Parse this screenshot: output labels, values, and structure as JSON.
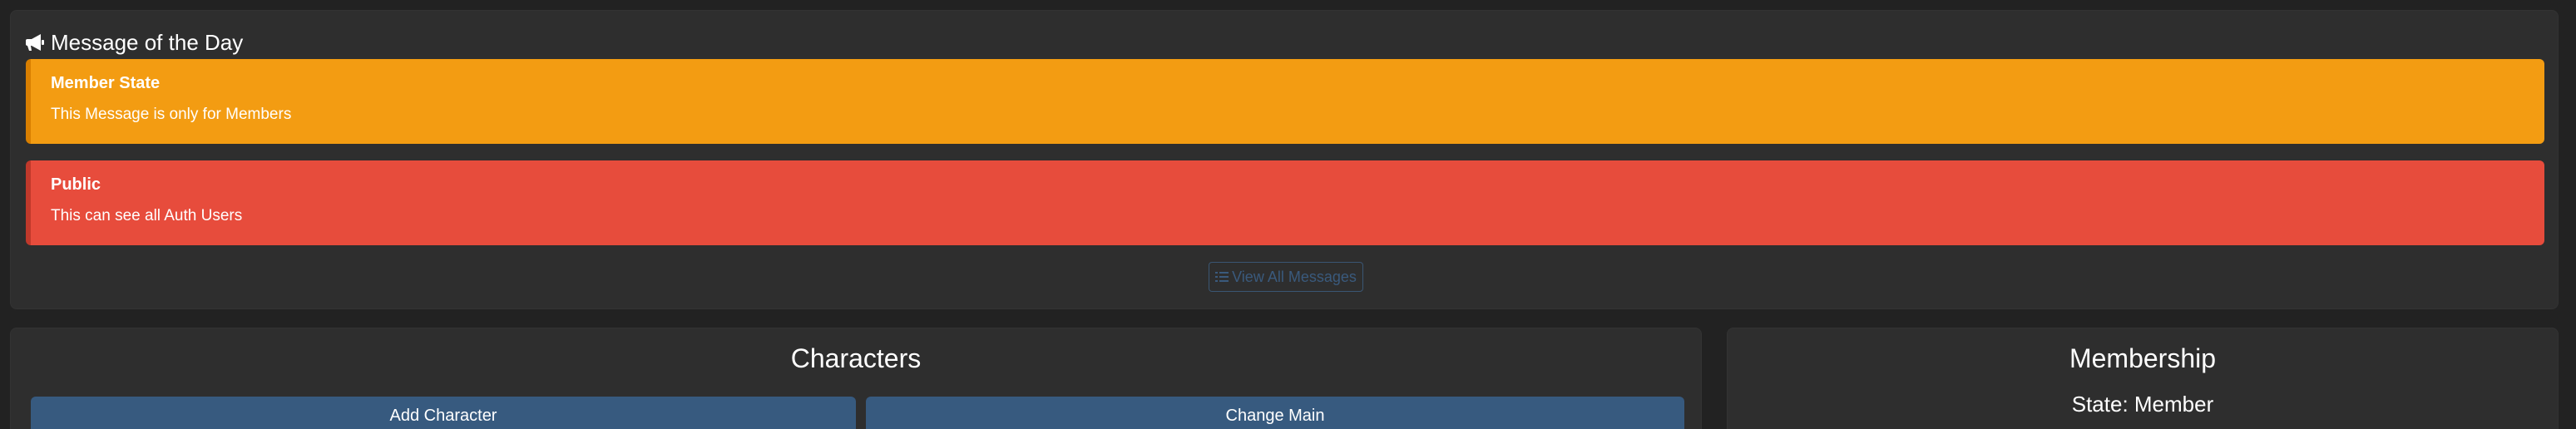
{
  "motd": {
    "title": "Message of the Day",
    "icon": "bullhorn-icon",
    "messages": [
      {
        "title": "Member State",
        "body": "This Message is only for Members",
        "color": "#f39c12"
      },
      {
        "title": "Public",
        "body": "This can see all Auth Users",
        "color": "#e74c3c"
      }
    ],
    "view_all_label": "View All Messages",
    "view_all_icon": "list-icon"
  },
  "characters": {
    "title": "Characters",
    "add_label": "Add Character",
    "change_main_label": "Change Main",
    "button_color": "#375a7f"
  },
  "membership": {
    "title": "Membership",
    "state": "State: Member"
  },
  "colors": {
    "background": "#222222",
    "panel": "#2e2e2e",
    "link": "#3a5a7d"
  }
}
